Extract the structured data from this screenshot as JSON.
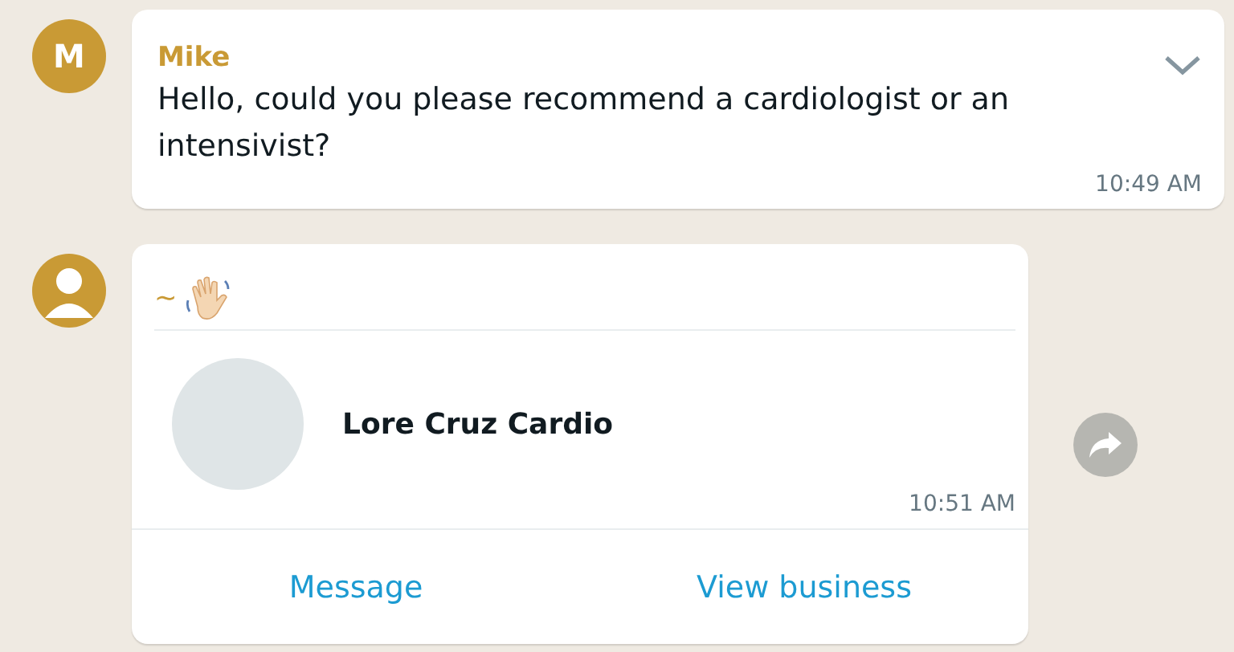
{
  "messages": [
    {
      "kind": "text",
      "avatar": {
        "kind": "initial",
        "text": "M"
      },
      "sender": "Mike",
      "text": "Hello, could you please recommend a cardiologist or an intensivist?",
      "time": "10:49 AM",
      "menu": true,
      "forward": false
    },
    {
      "kind": "contact",
      "avatar": {
        "kind": "silhouette"
      },
      "sender": "~",
      "sender_emoji": true,
      "contact_name": "Lore Cruz Cardio",
      "time": "10:51 AM",
      "actions": [
        "Message",
        "View business"
      ],
      "forward": true
    }
  ]
}
